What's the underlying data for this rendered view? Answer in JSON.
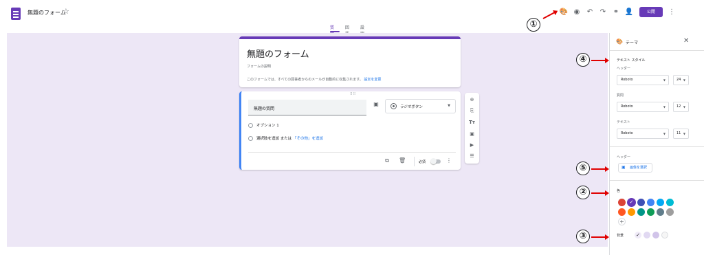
{
  "app": {
    "title": "無題のフォーム",
    "send_label": "公開"
  },
  "colors": {
    "accent": "#673ab7",
    "link": "#1a73e8",
    "arrow": "#e00000"
  },
  "toolbar_icons": [
    "palette-icon",
    "eye-icon",
    "undo-icon",
    "redo-icon",
    "link-icon",
    "add-collaborator-icon"
  ],
  "tabs": [
    "質問",
    "回答",
    "設定"
  ],
  "form": {
    "title": "無題のフォーム",
    "description": "フォームの説明",
    "notice": "このフォームでは、すべての回答者からのメールが自動的に収集されます。",
    "notice_link": "設定を変更"
  },
  "question": {
    "text": "無題の質問",
    "type": "ラジオボタン",
    "option1": "オプション 1",
    "add_option": "選択肢を追加",
    "or_text": "または",
    "add_other": "「その他」を追加",
    "required_label": "必須"
  },
  "side_toolbar_icons": [
    "add-question-icon",
    "import-questions-icon",
    "add-title-icon",
    "add-image-icon",
    "add-video-icon",
    "add-section-icon"
  ],
  "theme_panel": {
    "title": "テーマ",
    "text_style_label": "テキスト スタイル",
    "header_label": "ヘッダー",
    "header_font": "Roboto",
    "header_size": "24",
    "question_label": "質問",
    "question_font": "Roboto",
    "question_size": "12",
    "text_label": "テキスト",
    "text_font": "Roboto",
    "text_size": "11",
    "header_section_label": "ヘッダー",
    "select_image_label": "画像を選択",
    "color_label": "色",
    "selected_color": "#673ab7",
    "colors": [
      "#db4437",
      "#673ab7",
      "#3f51b5",
      "#4285f4",
      "#03a9f4",
      "#00bcd4",
      "#ff5722",
      "#ff9800",
      "#009688",
      "#0f9d58",
      "#607d8b",
      "#9e9e9e"
    ],
    "background_label": "背景",
    "background_colors": [
      "#f0ebf8",
      "#e1d9f2",
      "#d1c4e9",
      "#f6f6f6"
    ]
  },
  "callouts": [
    "①",
    "②",
    "③",
    "④",
    "⑤"
  ]
}
